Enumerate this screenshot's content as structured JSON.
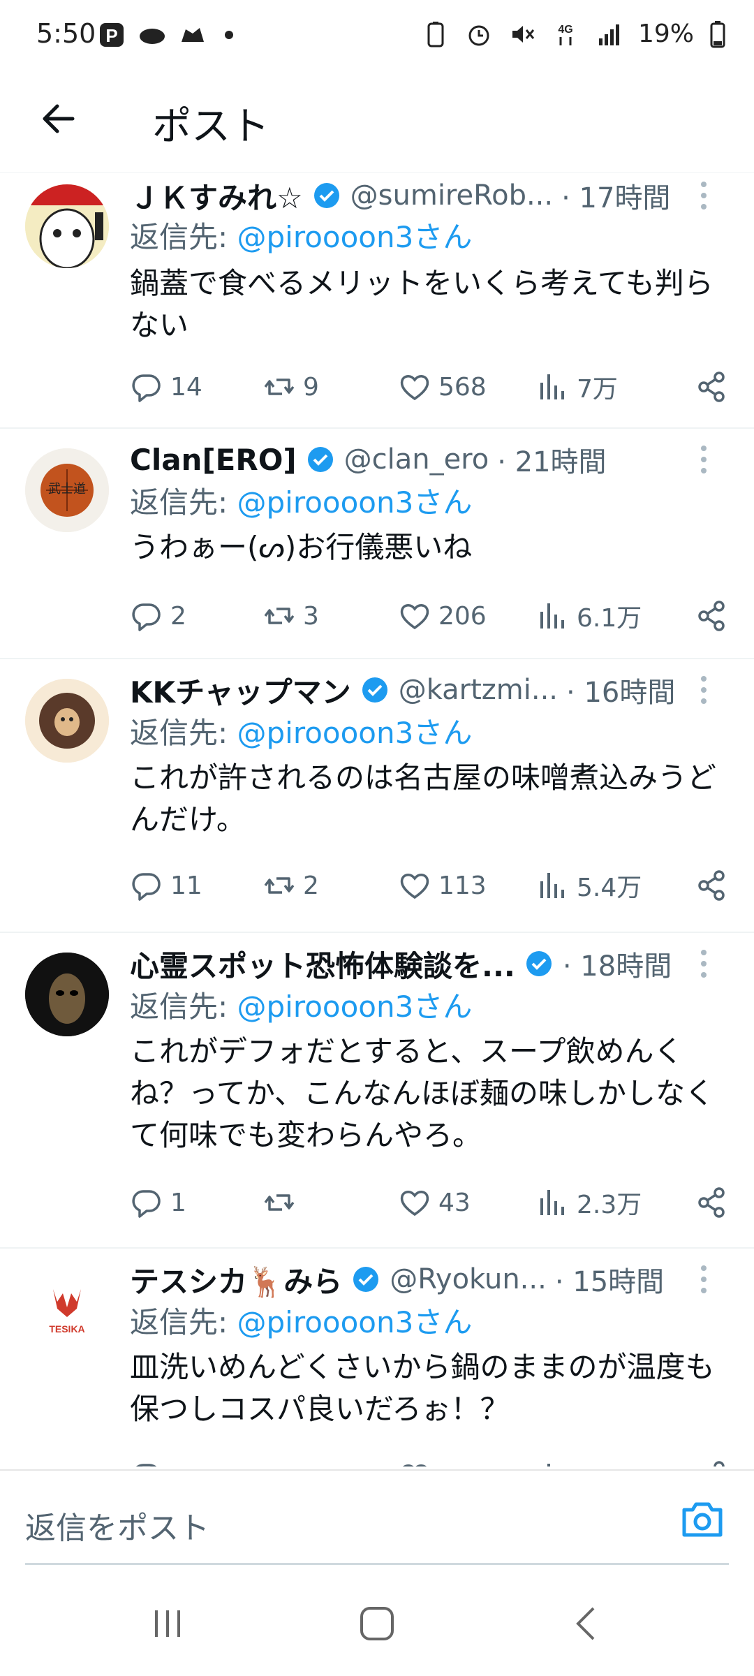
{
  "status_bar": {
    "time": "5:50",
    "left_icons": [
      "paypay-icon",
      "cloud-icon",
      "shoe-icon"
    ],
    "network": "4G",
    "battery": "19%"
  },
  "header": {
    "title": "ポスト"
  },
  "colors": {
    "accent": "#1d9bf0",
    "text": "#0f1419",
    "muted": "#536471",
    "divider": "#eff3f4"
  },
  "posts": [
    {
      "name": "ＪＫすみれ☆",
      "handle": "@sumireRob...",
      "time": "· 17時間",
      "reply_prefix": "返信先: ",
      "reply_to": "@piroooon3さん",
      "text": "鍋蓋で食べるメリットをいくら考えても判らない",
      "replies": "14",
      "reposts": "9",
      "likes": "568",
      "views": "7万"
    },
    {
      "name": "Clan[ERO]",
      "handle": "@clan_ero",
      "time": "· 21時間",
      "reply_prefix": "返信先: ",
      "reply_to": "@piroooon3さん",
      "text": "うわぁー(ᔕ)お行儀悪いね",
      "replies": "2",
      "reposts": "3",
      "likes": "206",
      "views": "6.1万"
    },
    {
      "name": "KKチャップマン",
      "handle": "@kartzmi...",
      "time": "· 16時間",
      "reply_prefix": "返信先: ",
      "reply_to": "@piroooon3さん",
      "text": "これが許されるのは名古屋の味噌煮込みうどんだけ。",
      "replies": "11",
      "reposts": "2",
      "likes": "113",
      "views": "5.4万"
    },
    {
      "name": "心霊スポット恐怖体験談を...",
      "handle": "",
      "time": "· 18時間",
      "reply_prefix": "返信先: ",
      "reply_to": "@piroooon3さん",
      "text": "これがデフォだとすると、スープ飲めんくね？ってか、こんなんほぼ麺の味しかしなくて何味でも変わらんやろ。",
      "replies": "1",
      "reposts": "",
      "likes": "43",
      "views": "2.3万"
    },
    {
      "name": "テスシカ🦌みら",
      "handle": "@Ryokun...",
      "time": "· 15時間",
      "reply_prefix": "返信先: ",
      "reply_to": "@piroooon3さん",
      "text": "皿洗いめんどくさいから鍋のままのが温度も保つしコスパ良いだろぉ！？",
      "replies": "",
      "reposts": "",
      "likes": "",
      "views": ""
    }
  ],
  "composer": {
    "placeholder": "返信をポスト"
  }
}
